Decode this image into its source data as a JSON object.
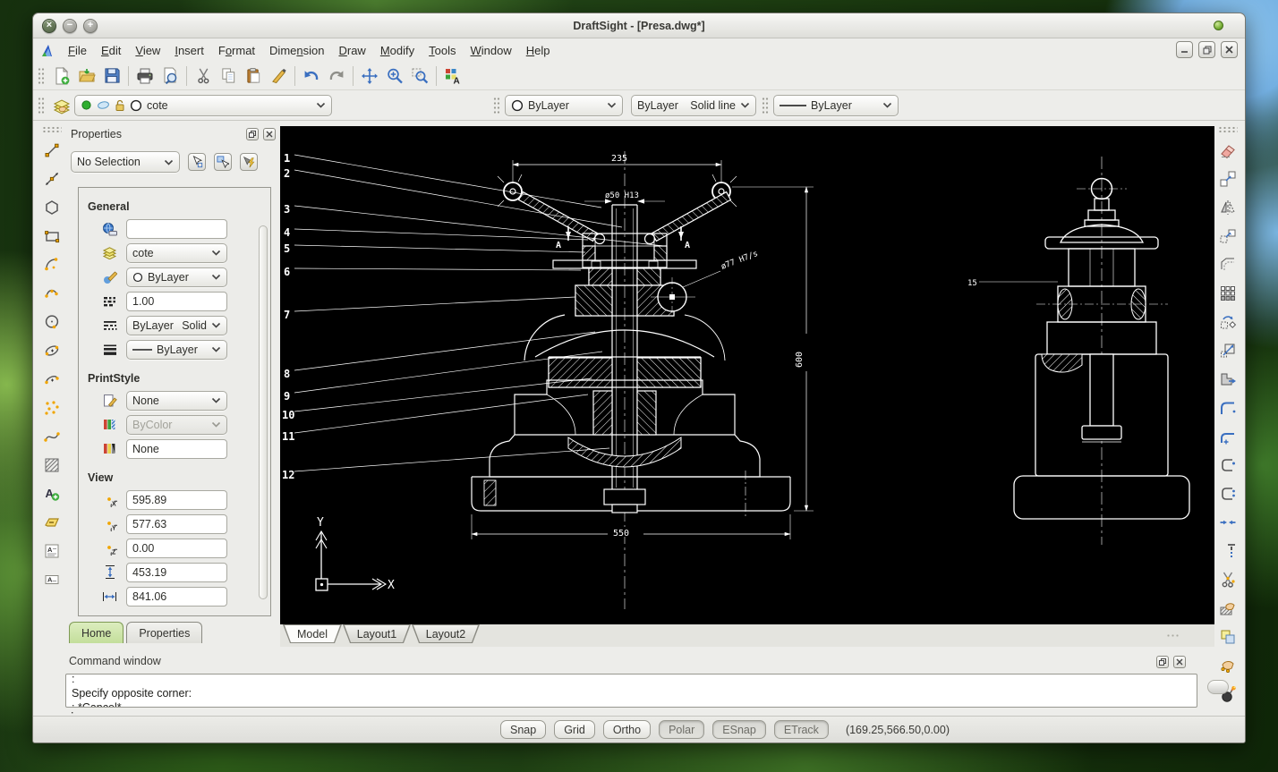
{
  "title": "DraftSight - [Presa.dwg*]",
  "menus": [
    "&File",
    "&Edit",
    "&View",
    "&Insert",
    "F&ormat",
    "Dime&nsion",
    "&Draw",
    "&Modify",
    "&Tools",
    "&Window",
    "&Help"
  ],
  "toolbar_icons": [
    "new",
    "open",
    "save",
    "print",
    "print-preview",
    "cut",
    "copy",
    "paste",
    "property-painter",
    "undo",
    "redo",
    "pan",
    "zoom-in",
    "zoom-window",
    "text-styles"
  ],
  "layerbar": {
    "layer": "cote",
    "color": "ByLayer",
    "linestyle_name": "ByLayer",
    "linestyle_kind": "Solid line",
    "lineweight": "ByLayer"
  },
  "props": {
    "title": "Properties",
    "selector": "No Selection",
    "general": {
      "h": "General",
      "hyperlink": "",
      "layer": "cote",
      "color": "ByLayer",
      "linescale": "1.00",
      "ls1": "ByLayer",
      "ls2": "Solid",
      "lw": "ByLayer"
    },
    "print": {
      "h": "PrintStyle",
      "style": "None",
      "bycolor": "ByColor",
      "table": "None"
    },
    "view": {
      "h": "View",
      "cx": "595.89",
      "cy": "577.63",
      "cz": "0.00",
      "height": "453.19",
      "width": "841.06"
    },
    "tabs": [
      "Home",
      "Properties"
    ]
  },
  "draw_tools": [
    "line",
    "infinite-line",
    "polygon",
    "rectangle",
    "arc",
    "curve",
    "circle",
    "ellipse",
    "ellipse-arc",
    "point",
    "spline",
    "hatch",
    "insert-text",
    "region",
    "note",
    "simple-note"
  ],
  "modify_tools": [
    "delete",
    "copy",
    "mirror",
    "offset",
    "offset-edges",
    "pattern",
    "rotate",
    "scale",
    "stretch",
    "fillet",
    "fillet-multi",
    "chamfer",
    "chamfer-multi",
    "trim",
    "extend",
    "split",
    "edit-hatch",
    "copy-nested",
    "edit-polyline",
    "explode"
  ],
  "doc_tabs": [
    "Model",
    "Layout1",
    "Layout2"
  ],
  "drawing": {
    "leaders": [
      "1",
      "2",
      "3",
      "4",
      "5",
      "6",
      "7",
      "8",
      "9",
      "10",
      "11",
      "12"
    ],
    "dim_top": "235",
    "dim_screw": "ø50 H13",
    "dim_bore": "ø77 H7/s",
    "dim_base": "550",
    "dim_side": "600",
    "side_leader": "15",
    "sec_a": "A",
    "axis_x": "X",
    "axis_y": "Y"
  },
  "cmd": {
    "label": "Command window",
    "l1": ":",
    "l2": "Specify opposite corner:",
    "l3": ": *Cancel*",
    "prompt": ":"
  },
  "status": {
    "b": [
      "Snap",
      "Grid",
      "Ortho",
      "Polar",
      "ESnap",
      "ETrack"
    ],
    "coords": "(169.25,566.50,0.00)"
  },
  "colors": {
    "accent_green": "#c3de9b",
    "canvas_bg": "#000000",
    "drawing_stroke": "#ffffff",
    "selection_blue": "#3a6fc0"
  }
}
